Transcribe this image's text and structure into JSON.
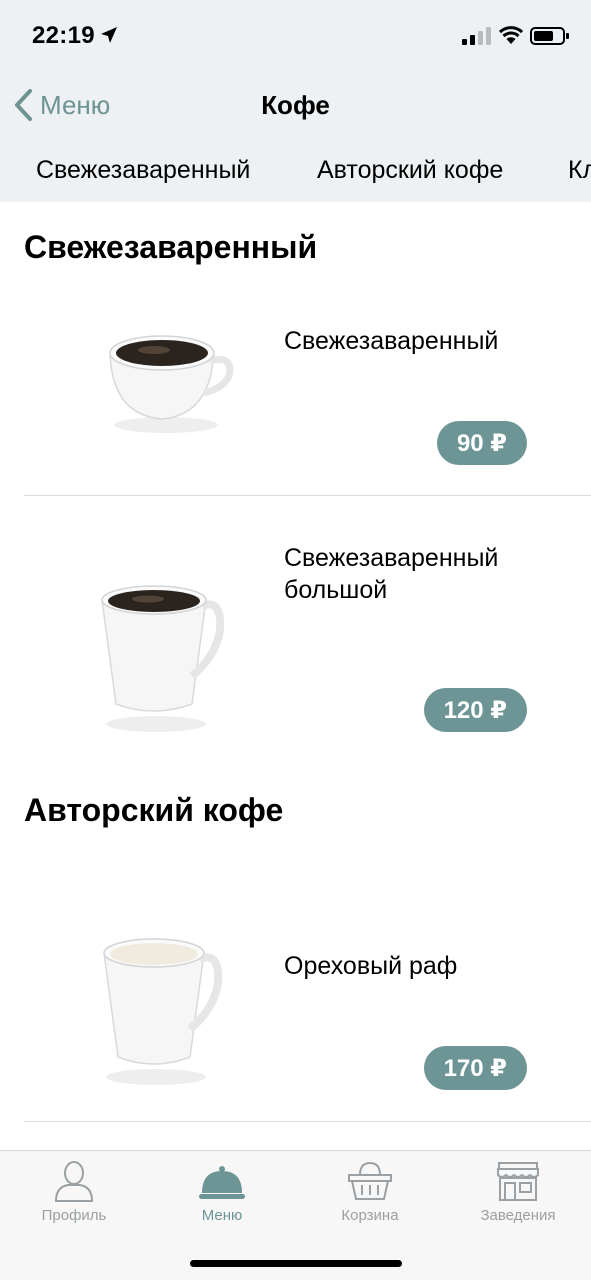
{
  "status_bar": {
    "time": "22:19"
  },
  "nav": {
    "back_label": "Меню",
    "title": "Кофе"
  },
  "category_tabs": [
    "Свежезаваренный",
    "Авторский кофе",
    "Кл"
  ],
  "sections": [
    {
      "title": "Свежезаваренный",
      "items": [
        {
          "name": "Свежезаваренный",
          "price": "90 ₽"
        },
        {
          "name": "Свежезаваренный большой",
          "price": "120 ₽"
        }
      ]
    },
    {
      "title": "Авторский кофе",
      "items": [
        {
          "name": "Ореховый раф",
          "price": "170 ₽"
        }
      ]
    }
  ],
  "tab_bar": [
    {
      "label": "Профиль",
      "icon": "profile-icon"
    },
    {
      "label": "Меню",
      "icon": "menu-cloche-icon",
      "active": true
    },
    {
      "label": "Корзина",
      "icon": "basket-icon"
    },
    {
      "label": "Заведения",
      "icon": "store-icon"
    }
  ],
  "colors": {
    "accent": "#6e9595",
    "nav_background": "#eef1f3",
    "inactive_tab": "#9aa0a3"
  }
}
